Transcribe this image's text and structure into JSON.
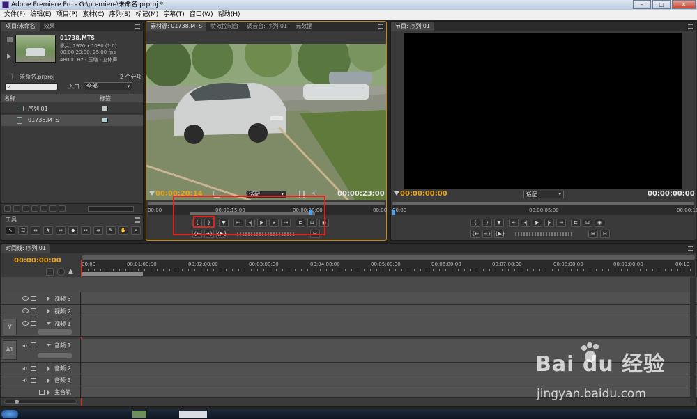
{
  "window": {
    "title": "Adobe Premiere Pro - G:\\premiere\\未命名.prproj *",
    "min": "–",
    "max": "□",
    "close": "✕"
  },
  "menu": [
    "文件(F)",
    "编辑(E)",
    "项目(P)",
    "素材(C)",
    "序列(S)",
    "标记(M)",
    "字幕(T)",
    "窗口(W)",
    "帮助(H)"
  ],
  "project": {
    "tabs": [
      "项目:未命名",
      "效果"
    ],
    "clip_name": "01738.MTS",
    "clip_info": [
      "影片, 1920 x 1080 (1.0)",
      "00:00:23:00, 25.00 fps",
      "48000 Hz - 压缩 - 立体声"
    ],
    "project_file": "未命名.prproj",
    "item_count": "2 个分项",
    "search_placeholder": "",
    "in_label": "入口:",
    "in_value": "全部",
    "col_name": "名称",
    "col_label": "标签",
    "items": [
      {
        "name": "序列 01"
      },
      {
        "name": "01738.MTS"
      }
    ]
  },
  "source": {
    "tabs": [
      "素材源: 01738.MTS",
      "特效控制台",
      "调音台: 序列 01",
      "元数据"
    ],
    "timecode_in": "00:00:20:14",
    "fit": "适配",
    "duration": "00:00:23:00",
    "ruler_labels": [
      "00:00",
      "00:00:15:00",
      "00:00:30:00",
      "00:00"
    ]
  },
  "program": {
    "tabs": [
      "节目: 序列 01"
    ],
    "timecode": "00:00:00:00",
    "fit": "适配",
    "duration": "00:00:00:00",
    "ruler_labels": [
      "00:00",
      "00:00:05:00",
      "00:00:10"
    ]
  },
  "tools": {
    "title": "工具"
  },
  "timeline": {
    "tab": "时间线: 序列 01",
    "timecode": "00:00:00:00",
    "ruler_labels": [
      "00:00",
      "00:01:00:00",
      "00:02:00:00",
      "00:03:00:00",
      "00:04:00:00",
      "00:05:00:00",
      "00:06:00:00",
      "00:07:00:00",
      "00:08:00:00",
      "00:09:00:00",
      "00:10"
    ],
    "video_tracks": [
      "视频 3",
      "视频 2",
      "视频 1"
    ],
    "audio_tracks": [
      "音频 1",
      "音频 2",
      "音频 3",
      "主音轨"
    ],
    "v_label": "V",
    "a_label": "A1"
  },
  "watermark": {
    "brand": "Bai du 经验",
    "url": "jingyan.baidu.com"
  },
  "colors": {
    "accent_timecode": "#e8a41a",
    "highlight_box": "#e0221c"
  }
}
